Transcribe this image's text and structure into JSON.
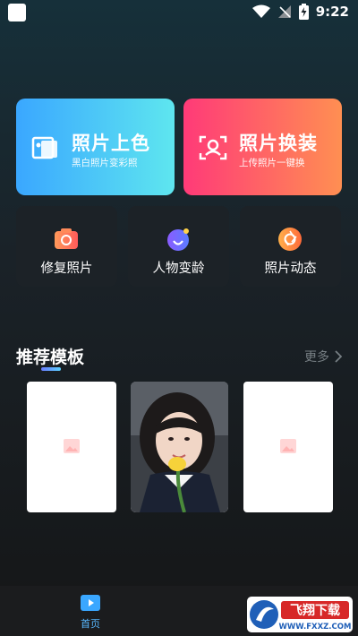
{
  "status": {
    "time": "9:22"
  },
  "cards": {
    "colorize": {
      "title": "照片上色",
      "subtitle": "黑白照片变彩照"
    },
    "swap": {
      "title": "照片换装",
      "subtitle": "上传照片一键换"
    }
  },
  "tools": [
    {
      "label": "修复照片"
    },
    {
      "label": "人物变龄"
    },
    {
      "label": "照片动态"
    }
  ],
  "section": {
    "title": "推荐模板",
    "more": "更多"
  },
  "nav": {
    "home": "首页"
  },
  "watermark": {
    "text": "飞翔下载",
    "url": "WWW.FXXZ.COM"
  }
}
